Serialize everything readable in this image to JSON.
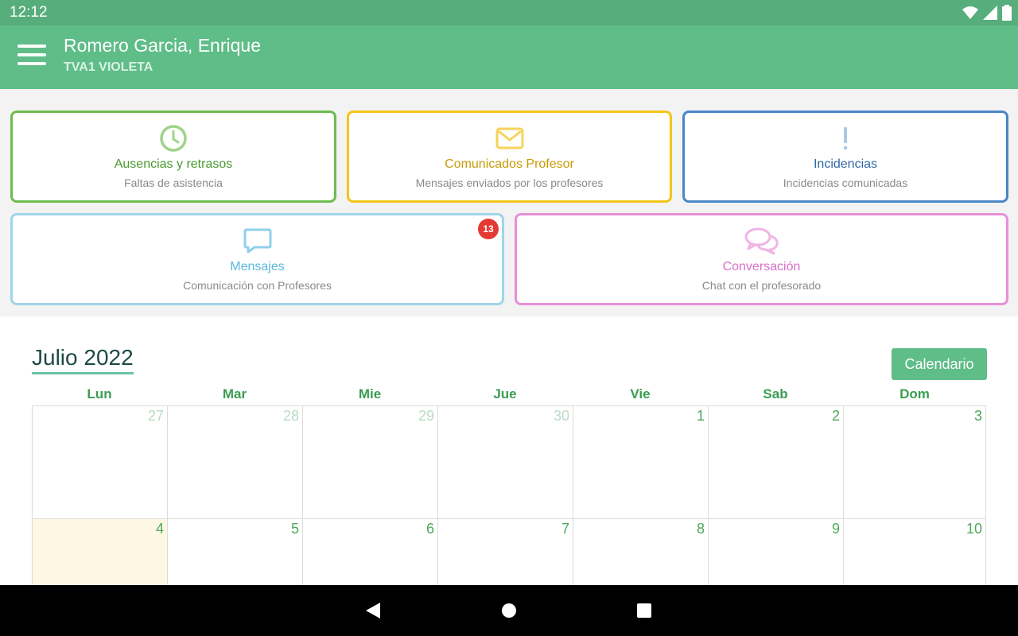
{
  "status_bar": {
    "time": "12:12",
    "icons": [
      "wifi-icon",
      "signal-icon",
      "battery-icon"
    ]
  },
  "app_bar": {
    "title": "Romero Garcia, Enrique",
    "subtitle": "TVA1 VIOLETA"
  },
  "tiles": [
    {
      "title": "Ausencias y retrasos",
      "subtitle": "Faltas de asistencia",
      "icon": "clock-icon",
      "color": "#6dbb4f",
      "title_color": "#4a9a2e",
      "icon_color": "#9fd38a"
    },
    {
      "title": "Comunicados Profesor",
      "subtitle": "Mensajes enviados por los profesores",
      "icon": "envelope-icon",
      "color": "#f5c518",
      "title_color": "#c99a06",
      "icon_color": "#f7d35a"
    },
    {
      "title": "Incidencias",
      "subtitle": "Incidencias comunicadas",
      "icon": "exclamation-icon",
      "color": "#4a86c8",
      "title_color": "#2f66a8",
      "icon_color": "#a9c8e8"
    },
    {
      "title": "Mensajes",
      "subtitle": "Comunicación con Profesores",
      "icon": "chat-bubble-icon",
      "color": "#9ed6e8",
      "title_color": "#5bb8dd",
      "icon_color": "#8fd0ea",
      "badge": "13"
    },
    {
      "title": "Conversación",
      "subtitle": "Chat con el profesorado",
      "icon": "chat-bubbles-icon",
      "color": "#e88fd8",
      "title_color": "#d66fc6",
      "icon_color": "#f0b4e6"
    }
  ],
  "calendar": {
    "month_title": "Julio 2022",
    "button_label": "Calendario",
    "weekdays": [
      "Lun",
      "Mar",
      "Mie",
      "Jue",
      "Vie",
      "Sab",
      "Dom"
    ],
    "weeks": [
      [
        {
          "d": "27",
          "other": true
        },
        {
          "d": "28",
          "other": true
        },
        {
          "d": "29",
          "other": true
        },
        {
          "d": "30",
          "other": true
        },
        {
          "d": "1"
        },
        {
          "d": "2"
        },
        {
          "d": "3"
        }
      ],
      [
        {
          "d": "4",
          "today": true
        },
        {
          "d": "5"
        },
        {
          "d": "6"
        },
        {
          "d": "7"
        },
        {
          "d": "8"
        },
        {
          "d": "9"
        },
        {
          "d": "10"
        }
      ]
    ]
  },
  "nav_bar": {
    "buttons": [
      "back-icon",
      "home-icon",
      "recents-icon"
    ]
  },
  "colors": {
    "primary": "#5fbd88",
    "status_bar": "#57ad7c",
    "accent_green": "#4ea95b",
    "today_bg": "#fdf7e3"
  }
}
